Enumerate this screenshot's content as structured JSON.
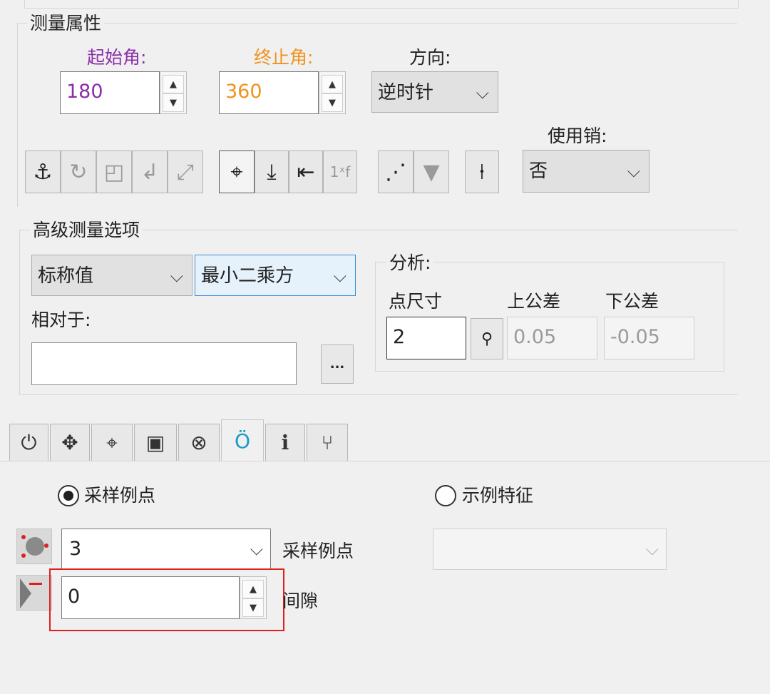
{
  "measure_props": {
    "title": "测量属性",
    "start_angle": {
      "label": "起始角:",
      "value": "180",
      "color": "#8b2ea8"
    },
    "end_angle": {
      "label": "终止角:",
      "value": "360",
      "color": "#f0921c"
    },
    "direction": {
      "label": "方向:",
      "value": "逆时针"
    },
    "use_pin": {
      "label": "使用销:",
      "value": "否"
    },
    "toolbar_icons": [
      "anchor-icon",
      "rotate-icon",
      "frame-icon",
      "return-icon",
      "scale-icon",
      "crosshair-icon",
      "align-down-icon",
      "align-left-icon",
      "1xf-icon",
      "dots-icon",
      "filter-icon",
      "pin-icon"
    ]
  },
  "advanced": {
    "title": "高级测量选项",
    "nominal": "标称值",
    "method": "最小二乘方",
    "relative_label": "相对于:",
    "relative_value": "",
    "browse": "...",
    "analysis": {
      "title": "分析:",
      "point_size_label": "点尺寸",
      "point_size": "2",
      "upper_label": "上公差",
      "upper": "0.05",
      "lower_label": "下公差",
      "lower": "-0.05"
    }
  },
  "tabs": [
    {
      "name": "power-icon",
      "glyph": "⏻"
    },
    {
      "name": "probe-icon",
      "glyph": "✥"
    },
    {
      "name": "crosshair-icon",
      "glyph": "⌖"
    },
    {
      "name": "image-icon",
      "glyph": "▣"
    },
    {
      "name": "target-icon",
      "glyph": "⊗"
    },
    {
      "name": "circle-fit-icon",
      "glyph": "Ö"
    },
    {
      "name": "info-icon",
      "glyph": "ℹ"
    },
    {
      "name": "fork-icon",
      "glyph": "⑂"
    }
  ],
  "sampling": {
    "option_sample_points": "采样例点",
    "option_sample_feature": "示例特征",
    "points_value": "3",
    "points_label": "采样例点",
    "gap_value": "0",
    "gap_label": "间隙",
    "highlight_color": "#e02020"
  }
}
